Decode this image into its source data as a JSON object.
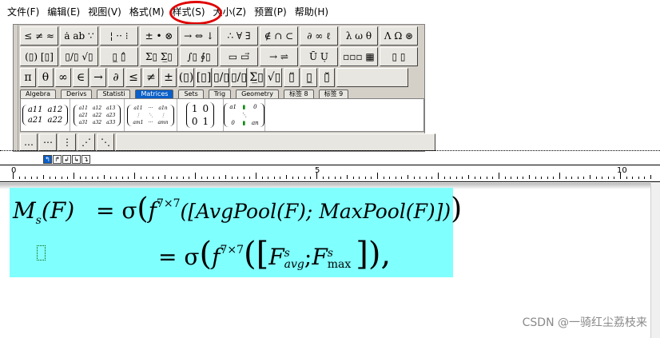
{
  "menu": {
    "items": [
      "文件(F)",
      "编辑(E)",
      "视图(V)",
      "格式(M)",
      "样式(S)",
      "大小(Z)",
      "预置(P)",
      "帮助(H)"
    ]
  },
  "toolbar": {
    "row1": [
      "≤ ≠ ≈",
      "ȧ ab ∵",
      "¦ ·· ⁝",
      "± • ⊗",
      "→ ⇔ ↓",
      "∴ ∀ ∃",
      "∉ ∩ ⊂",
      "∂ ∞ ℓ",
      "λ ω θ",
      "Λ Ω ⊛"
    ],
    "row2": [
      "(▯) [▯]",
      "▯/▯ √▯",
      "▯̲ ▯̂",
      "Σ▯ Σ̲▯",
      "∫▯ ∮▯",
      "▭ ▭⃗",
      "→ ⇌",
      "Ū Ụ",
      "▫▫▫ ▦",
      "▯ ▯"
    ],
    "row3": [
      "π",
      "θ",
      "∞",
      "∈",
      "→",
      "∂",
      "≤",
      "≠",
      "±",
      "(▯)",
      "[▯]",
      "▯/▯",
      "▯/▯",
      "Σ̲▯",
      "√▯",
      "▯̈",
      "▯̲",
      "▯̆"
    ],
    "tabs": [
      "Algebra",
      "Derivs",
      "Statisti",
      "Matrices",
      "Sets",
      "Trig",
      "Geometry",
      "标签 8",
      "标签 9"
    ],
    "active_tab": "Matrices",
    "templates": {
      "m2x2": [
        "a11",
        "a12",
        "a21",
        "a22"
      ],
      "m3x3": [
        "a11",
        "a12",
        "a13",
        "a21",
        "a22",
        "a23",
        "a31",
        "a32",
        "a33"
      ],
      "mmxn": [
        "a11",
        "···",
        "a1n",
        "⋮",
        "⋱",
        "⋮",
        "am1",
        "···",
        "amn"
      ],
      "identity": [
        "1",
        "0",
        "0",
        "1"
      ],
      "diag": [
        "a1",
        "0",
        "⋱",
        "0",
        "an"
      ]
    },
    "dots_row": [
      "…",
      "⋯",
      "⋮",
      "⋰",
      "⋱"
    ]
  },
  "ruler": {
    "controls": [
      "↰",
      "↱",
      "↲",
      "↳",
      "↴"
    ],
    "labels": [
      "0",
      "5",
      "10"
    ]
  },
  "equation": {
    "line1": {
      "lhs_M": "M",
      "lhs_sub": "s",
      "lhs_arg": "(F)",
      "eq": "= σ",
      "f": "f",
      "f_sup": "7×7",
      "body": "([AvgPool(F); MaxPool(F)])"
    },
    "line2": {
      "eq": "= σ",
      "f": "f",
      "f_sup": "7×7",
      "F1": "F",
      "F1_sup": "s",
      "F1_sub": "avg",
      "sep": ";",
      "F2": "F",
      "F2_sup": "s",
      "F2_sub": "max",
      "tail": "),"
    }
  },
  "watermark": "CSDN @一骑红尘荔枝来",
  "colors": {
    "selection": "#80ffff",
    "active_tab": "#0a5fc8",
    "annotation": "#e00000"
  }
}
